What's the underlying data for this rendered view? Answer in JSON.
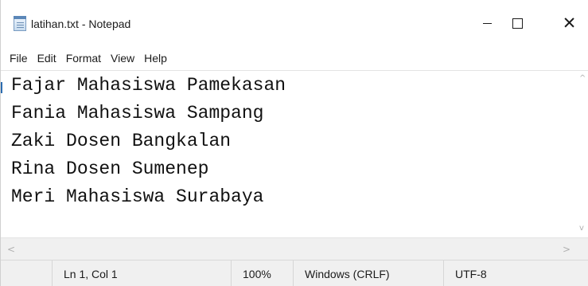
{
  "window": {
    "title": "latihan.txt - Notepad",
    "icon": "notepad-icon",
    "controls": {
      "minimize": "minimize-icon",
      "maximize": "maximize-icon",
      "close": "close-icon",
      "close_glyph": "✕"
    }
  },
  "menu": {
    "items": [
      "File",
      "Edit",
      "Format",
      "View",
      "Help"
    ]
  },
  "editor": {
    "lines": [
      "Fajar Mahasiswa Pamekasan",
      "Fania Mahasiswa Sampang",
      "Zaki Dosen Bangkalan",
      "Rina Dosen Sumenep",
      "Meri Mahasiswa Surabaya"
    ]
  },
  "scrollbars": {
    "up_arrow": "^",
    "down_arrow": "v",
    "left_arrow": "<",
    "right_arrow": ">"
  },
  "status": {
    "position": "Ln 1, Col 1",
    "zoom": "100%",
    "line_ending": "Windows (CRLF)",
    "encoding": "UTF-8"
  },
  "colors": {
    "background": "#ffffff",
    "chrome": "#f0f0f0",
    "text": "#1b1b1b"
  }
}
